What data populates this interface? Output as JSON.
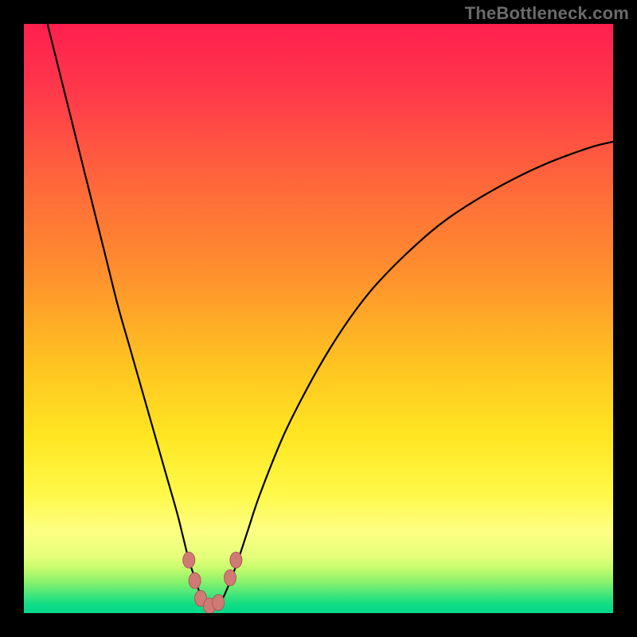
{
  "watermark": "TheBottleneck.com",
  "colors": {
    "black": "#000000",
    "curve": "#000000",
    "marker": "#cf7a74",
    "marker_stroke": "#ad5a55"
  },
  "gradient_stops": [
    {
      "y": 0.0,
      "color": "#ff1f4e"
    },
    {
      "y": 0.12,
      "color": "#ff3a4a"
    },
    {
      "y": 0.28,
      "color": "#ff6a3a"
    },
    {
      "y": 0.42,
      "color": "#ff8f2e"
    },
    {
      "y": 0.58,
      "color": "#ffc421"
    },
    {
      "y": 0.7,
      "color": "#ffe622"
    },
    {
      "y": 0.8,
      "color": "#fff94a"
    },
    {
      "y": 0.86,
      "color": "#fdff83"
    },
    {
      "y": 0.905,
      "color": "#e4ff7a"
    },
    {
      "y": 0.925,
      "color": "#c3fb6c"
    },
    {
      "y": 0.945,
      "color": "#8ef36b"
    },
    {
      "y": 0.965,
      "color": "#4fe878"
    },
    {
      "y": 0.985,
      "color": "#10dd85"
    },
    {
      "y": 1.0,
      "color": "#00d88b"
    }
  ],
  "chart_data": {
    "type": "line",
    "title": "",
    "xlabel": "",
    "ylabel": "",
    "xlim": [
      0,
      100
    ],
    "ylim": [
      0,
      100
    ],
    "grid": false,
    "legend": false,
    "series": [
      {
        "name": "bottleneck",
        "x": [
          4,
          6,
          8,
          10,
          12,
          14,
          16,
          18,
          20,
          22,
          24,
          26,
          27,
          28,
          29,
          30,
          31,
          32,
          33,
          34,
          36,
          38,
          40,
          44,
          48,
          52,
          56,
          60,
          66,
          72,
          80,
          88,
          96,
          100
        ],
        "y": [
          100,
          92,
          84,
          76,
          68,
          60,
          52,
          45,
          38,
          31,
          24,
          17,
          13,
          9,
          6,
          3,
          1.5,
          1,
          1.5,
          3,
          8,
          14,
          20,
          30,
          38,
          45,
          51,
          56,
          62,
          67,
          72,
          76,
          79,
          80
        ]
      }
    ],
    "markers": [
      {
        "x": 28.0,
        "y": 9.0
      },
      {
        "x": 29.0,
        "y": 5.5
      },
      {
        "x": 30.0,
        "y": 2.5
      },
      {
        "x": 31.5,
        "y": 1.2
      },
      {
        "x": 33.0,
        "y": 1.8
      },
      {
        "x": 35.0,
        "y": 6.0
      },
      {
        "x": 36.0,
        "y": 9.0
      }
    ]
  }
}
